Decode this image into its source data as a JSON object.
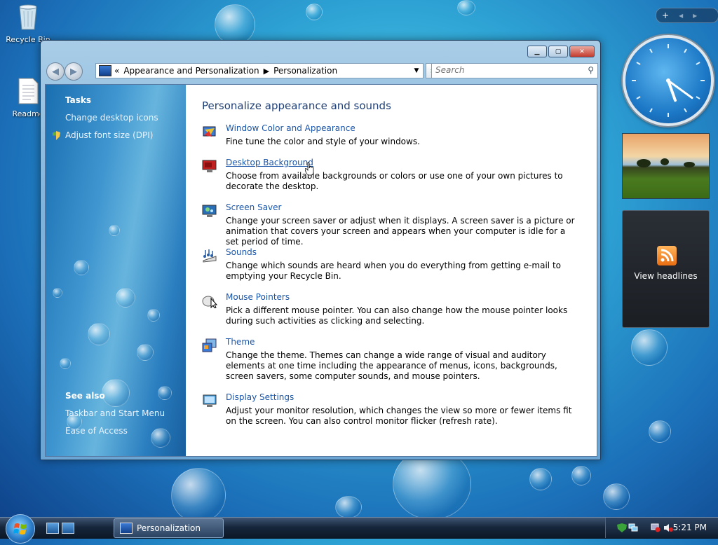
{
  "desktop": {
    "icons": [
      {
        "label": "Recycle Bin"
      },
      {
        "label": "Readme"
      }
    ]
  },
  "window": {
    "title_buttons": {
      "minimize": "▁",
      "maximize": "▢",
      "close": "✕"
    },
    "address": {
      "prefix": "«",
      "crumbs": [
        "Appearance and Personalization",
        "Personalization"
      ]
    },
    "search": {
      "placeholder": "Search"
    },
    "sidebar": {
      "tasks_heading": "Tasks",
      "tasks": [
        "Change desktop icons",
        "Adjust font size (DPI)"
      ],
      "see_also_heading": "See also",
      "see_also": [
        "Taskbar and Start Menu",
        "Ease of Access"
      ]
    },
    "main": {
      "title": "Personalize appearance and sounds",
      "items": [
        {
          "link": "Window Color and Appearance",
          "desc": "Fine tune the color and style of your windows.",
          "icon": "palette-icon"
        },
        {
          "link": "Desktop Background",
          "desc": "Choose from available backgrounds or colors or use one of your own pictures to decorate the desktop.",
          "icon": "desktop-background-icon"
        },
        {
          "link": "Screen Saver",
          "desc": "Change your screen saver or adjust when it displays. A screen saver is a picture or animation that covers your screen and appears when your computer is idle for a set period of time.",
          "icon": "screen-saver-icon"
        },
        {
          "link": "Sounds",
          "desc": "Change which sounds are heard when you do everything from getting e-mail to emptying your Recycle Bin.",
          "icon": "sounds-icon"
        },
        {
          "link": "Mouse Pointers",
          "desc": "Pick a different mouse pointer. You can also change how the mouse pointer looks during such activities as clicking and selecting.",
          "icon": "mouse-icon"
        },
        {
          "link": "Theme",
          "desc": "Change the theme. Themes can change a wide range of visual and auditory elements at one time including the appearance of menus, icons, backgrounds, screen savers, some computer sounds, and mouse pointers.",
          "icon": "theme-icon"
        },
        {
          "link": "Display Settings",
          "desc": "Adjust your monitor resolution, which changes the view so more or fewer items fit on the screen. You can also control monitor flicker (refresh rate).",
          "icon": "monitor-icon"
        }
      ]
    }
  },
  "sidebar_gadgets": {
    "bar": {
      "add": "+",
      "prev": "◂",
      "next": "▸"
    },
    "clock": {
      "hour": 5,
      "minute": 21
    },
    "feed": {
      "label": "View headlines"
    }
  },
  "taskbar": {
    "task_label": "Personalization",
    "time": "5:21 PM"
  },
  "colors": {
    "link": "#1a55a8",
    "title": "#1e3f78"
  }
}
